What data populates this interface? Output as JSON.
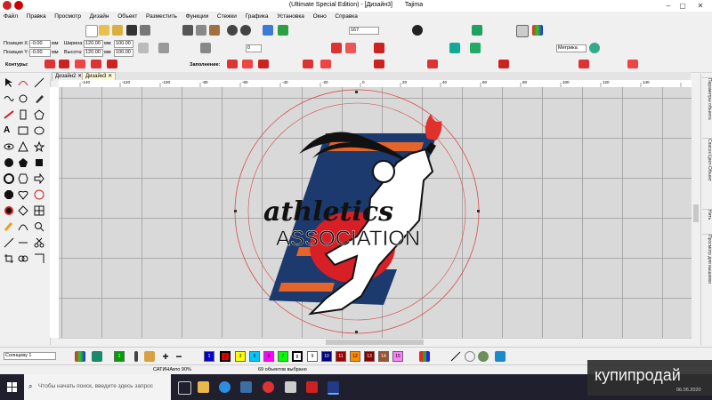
{
  "window": {
    "title": "(Ultimate Special Edition) - [Дизайн3",
    "title_sep": "]",
    "product": "Tajima"
  },
  "menu": [
    "Файл",
    "Правка",
    "Просмотр",
    "Дизайн",
    "Объект",
    "Разместить",
    "Функции",
    "Стежки",
    "Графика",
    "Установка",
    "Окно",
    "Справка"
  ],
  "props": {
    "pos_x_label": "Позиция X:",
    "pos_x_value": "-0.00",
    "pos_x_unit": "мм",
    "pos_y_label": "Позиция Y:",
    "pos_y_value": "-0.00",
    "pos_y_unit": "мм",
    "width_label": "Ширина:",
    "width_value": "120.00",
    "width_unit": "мм",
    "width_pct": "100.00",
    "height_label": "Высота:",
    "height_value": "120.00",
    "height_unit": "мм",
    "height_pct": "100.00",
    "zoom_value": "167",
    "angle_value": "0",
    "units_value": "Метрика"
  },
  "contour_bar": {
    "contours_label": "Контуры:",
    "fill_label": "Заполнение:"
  },
  "tabs": [
    "Дизайн2",
    "Дизайн3"
  ],
  "ruler_top": [
    "-140",
    "-120",
    "-100",
    "-80",
    "-60",
    "-40",
    "-20",
    "0",
    "20",
    "40",
    "60",
    "80",
    "100",
    "120",
    "140"
  ],
  "design": {
    "line1": "athletics",
    "line2": "ASSOCIATION"
  },
  "right_panel_tabs": [
    "Параметры объекта",
    "Список Цвет-Объект",
    "Нить",
    "Просмотр для вышивки"
  ],
  "bottom": {
    "thread_value": "Солнцеву 1",
    "color_slots": [
      {
        "n": "1",
        "color": "#00a000"
      },
      {
        "n": "1",
        "color": "#0000c8"
      },
      {
        "n": "2",
        "color": "#e00000"
      },
      {
        "n": "3",
        "color": "#ffff00"
      },
      {
        "n": "4",
        "color": "#ffff00"
      },
      {
        "n": "5",
        "color": "#00c8ff"
      },
      {
        "n": "6",
        "color": "#ff00ff"
      },
      {
        "n": "7",
        "color": "#00ff00"
      },
      {
        "n": "8",
        "color": "#000000"
      },
      {
        "n": "9",
        "color": "#ffffff"
      },
      {
        "n": "10",
        "color": "#000080"
      },
      {
        "n": "11",
        "color": "#a00000"
      },
      {
        "n": "12",
        "color": "#ff8c00"
      },
      {
        "n": "13",
        "color": "#8b0000"
      },
      {
        "n": "14",
        "color": "#a0522d"
      },
      {
        "n": "15",
        "color": "#ff80ff"
      }
    ]
  },
  "status": {
    "stitch_type": "САТИНАвто 90%",
    "selection": "69 объектов выбрано"
  },
  "taskbar": {
    "search_placeholder": "Чтобы начать поиск, введите здесь запрос",
    "date": "06.06.2020"
  },
  "watermark": "купипродай",
  "colors": {
    "navy": "#1c3a6e",
    "orange": "#e3652a",
    "red": "#d81f26",
    "torch_red": "#e0322b",
    "circle": "#d94a4a"
  }
}
